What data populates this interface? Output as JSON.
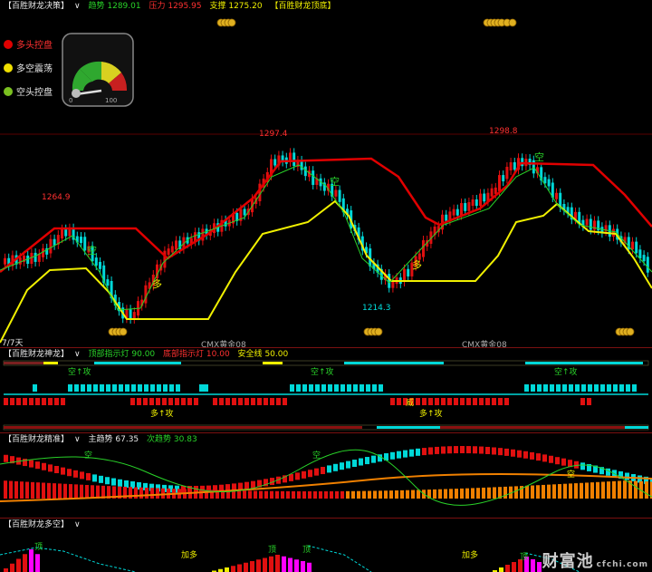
{
  "panel1": {
    "title": "【百胜财龙决策】",
    "trend_label": "趋势",
    "trend_value": "1289.01",
    "pressure_label": "压力",
    "pressure_value": "1295.95",
    "support_label": "支撑",
    "support_value": "1275.20",
    "extra_title": "【百胜财龙顶底】",
    "legend": [
      {
        "label": "多头控盘",
        "color": "#e00000"
      },
      {
        "label": "多空震荡",
        "color": "#f0e000"
      },
      {
        "label": "空头控盘",
        "color": "#7ac020"
      }
    ],
    "gauge_min": "0",
    "gauge_max": "100",
    "gauge_level": 12,
    "price_labels": [
      "1264.9",
      "1297.4",
      "1298.8",
      "1214.3"
    ],
    "signal_labels": [
      "空",
      "多",
      "空",
      "多",
      "空"
    ],
    "bottom_left": "7/7天",
    "contract_labels": [
      "CMX黄金08",
      "CMX黄金08"
    ],
    "coin_count": 4
  },
  "panel2": {
    "title": "【百胜财龙神龙】",
    "top_label": "顶部指示灯",
    "top_value": "90.00",
    "bottom_label": "底部指示灯",
    "bottom_value": "10.00",
    "safe_label": "安全线",
    "safe_value": "50.00",
    "tags": [
      "空↑攻",
      "空↑攻",
      "空↑攻",
      "多↑攻",
      "多↑攻",
      "威"
    ]
  },
  "panel3": {
    "title": "【百胜财龙精准】",
    "main_label": "主趋势",
    "main_value": "67.35",
    "sub_label": "次趋势",
    "sub_value": "30.83",
    "markers": [
      "空",
      "空",
      "空"
    ]
  },
  "panel4": {
    "title": "【百胜财龙多空】",
    "tags": [
      "加多",
      "加多"
    ],
    "markers": [
      "顶",
      "顶",
      "顶",
      "顶"
    ],
    "watermark": "财富池",
    "watermark_url": "cfchi.com"
  },
  "colors": {
    "up": "#e01010",
    "down": "#00d8d8",
    "yellow": "#f0f000",
    "red_line": "#e00000",
    "green": "#29d329",
    "magenta": "#ff00ff"
  }
}
